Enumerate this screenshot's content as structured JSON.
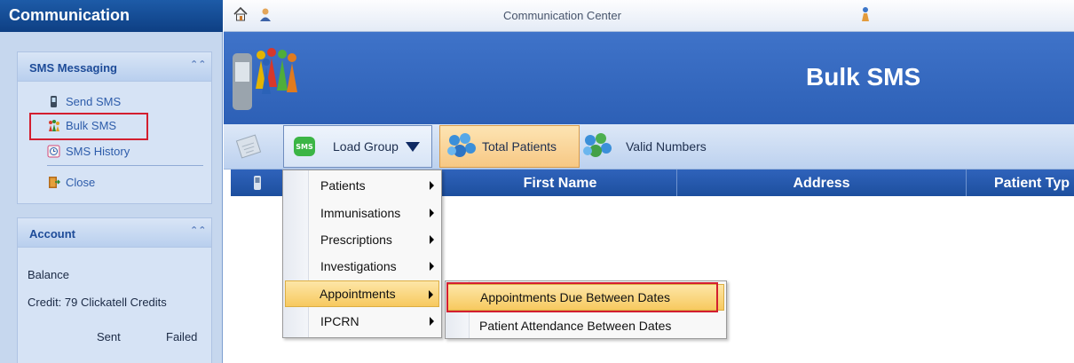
{
  "leftnav": {
    "title": "Communication",
    "sms_panel": {
      "title": "SMS Messaging",
      "items": [
        {
          "label": "Send SMS",
          "icon": "phone-icon"
        },
        {
          "label": "Bulk SMS",
          "icon": "people-icon"
        },
        {
          "label": "SMS History",
          "icon": "history-icon"
        },
        {
          "label": "Close",
          "icon": "close-door-icon"
        }
      ]
    },
    "account_panel": {
      "title": "Account",
      "balance_label": "Balance",
      "credit_text": "Credit: 79 Clickatell Credits",
      "sent_label": "Sent",
      "failed_label": "Failed"
    }
  },
  "topbar": {
    "title": "Communication Center",
    "icons": [
      "home-icon",
      "user-icon",
      "info-icon"
    ]
  },
  "banner": {
    "title": "Bulk SMS"
  },
  "toolbar": {
    "load_group": "Load Group",
    "total_patients": "Total Patients",
    "valid_numbers": "Valid Numbers"
  },
  "grid": {
    "columns": [
      "First Name",
      "Address",
      "Patient Typ"
    ]
  },
  "menu": {
    "items": [
      {
        "label": "Patients",
        "submenu": true
      },
      {
        "label": "Immunisations",
        "submenu": true
      },
      {
        "label": "Prescriptions",
        "submenu": true
      },
      {
        "label": "Investigations",
        "submenu": true
      },
      {
        "label": "Appointments",
        "submenu": true,
        "selected": true
      },
      {
        "label": "IPCRN",
        "submenu": true
      }
    ]
  },
  "submenu": {
    "items": [
      {
        "label": "Appointments Due Between Dates",
        "selected": true
      },
      {
        "label": "Patient Attendance Between Dates"
      }
    ]
  },
  "colors": {
    "highlight_red": "#d31e2f",
    "header_blue": "#1d5ba8",
    "menu_selected": "#f7c95f"
  }
}
